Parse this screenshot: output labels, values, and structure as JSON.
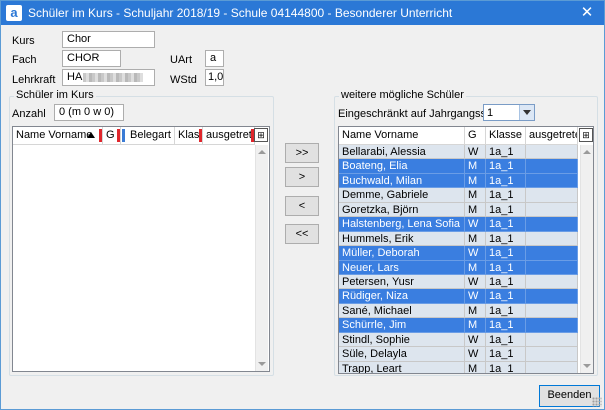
{
  "window": {
    "title": "Schüler im Kurs - Schuljahr 2018/19 - Schule 04144800  - Besonderer Unterricht",
    "app_icon": "a",
    "close": "✕"
  },
  "form": {
    "kurs_label": "Kurs",
    "kurs_value": "Chor",
    "fach_label": "Fach",
    "fach_value": "CHOR",
    "lehrkraft_label": "Lehrkraft",
    "lehrkraft_value": "HA",
    "uart_label": "UArt",
    "uart_value": "a",
    "wstd_label": "WStd",
    "wstd_value": "1,0"
  },
  "left_group": {
    "title": "Schüler im Kurs",
    "anzahl_label": "Anzahl",
    "anzahl_value": "0 (m 0 w 0)",
    "columns": [
      "Name Vorname",
      "G",
      "Belegart",
      "Klasse",
      "ausgetret..."
    ]
  },
  "move_buttons": {
    "add_all": ">>",
    "add": ">",
    "remove": "<",
    "remove_all": "<<"
  },
  "right_group": {
    "title": "weitere mögliche Schüler",
    "filter_label": "Eingeschränkt auf Jahrgangsstufe",
    "filter_value": "1",
    "columns": [
      "Name Vorname",
      "G",
      "Klasse",
      "ausgetreten"
    ],
    "rows": [
      {
        "name": "Bellarabi, Alessia",
        "g": "W",
        "klasse": "1a_1",
        "ausgetreten": "",
        "selected": false
      },
      {
        "name": "Boateng, Elia",
        "g": "M",
        "klasse": "1a_1",
        "ausgetreten": "",
        "selected": true
      },
      {
        "name": "Buchwald, Milan",
        "g": "M",
        "klasse": "1a_1",
        "ausgetreten": "",
        "selected": true
      },
      {
        "name": "Demme, Gabriele",
        "g": "M",
        "klasse": "1a_1",
        "ausgetreten": "",
        "selected": false
      },
      {
        "name": "Goretzka, Björn",
        "g": "M",
        "klasse": "1a_1",
        "ausgetreten": "",
        "selected": false
      },
      {
        "name": "Halstenberg, Lena Sofia",
        "g": "W",
        "klasse": "1a_1",
        "ausgetreten": "",
        "selected": true
      },
      {
        "name": "Hummels, Erik",
        "g": "M",
        "klasse": "1a_1",
        "ausgetreten": "",
        "selected": false
      },
      {
        "name": "Müller, Deborah",
        "g": "W",
        "klasse": "1a_1",
        "ausgetreten": "",
        "selected": true
      },
      {
        "name": "Neuer, Lars",
        "g": "M",
        "klasse": "1a_1",
        "ausgetreten": "",
        "selected": true
      },
      {
        "name": "Petersen, Yusr",
        "g": "W",
        "klasse": "1a_1",
        "ausgetreten": "",
        "selected": false
      },
      {
        "name": "Rüdiger, Niza",
        "g": "W",
        "klasse": "1a_1",
        "ausgetreten": "",
        "selected": true
      },
      {
        "name": "Sané, Michael",
        "g": "M",
        "klasse": "1a_1",
        "ausgetreten": "",
        "selected": false
      },
      {
        "name": "Schürrle, Jim",
        "g": "M",
        "klasse": "1a_1",
        "ausgetreten": "",
        "selected": true
      },
      {
        "name": "Stindl, Sophie",
        "g": "W",
        "klasse": "1a_1",
        "ausgetreten": "",
        "selected": false
      },
      {
        "name": "Süle, Delayla",
        "g": "W",
        "klasse": "1a_1",
        "ausgetreten": "",
        "selected": false
      },
      {
        "name": "Trapp, Leart",
        "g": "M",
        "klasse": "1a_1",
        "ausgetreten": "",
        "selected": false
      }
    ]
  },
  "footer": {
    "close_label": "Beenden"
  },
  "colors": {
    "titlebar": "#2b78d6",
    "selection": "#3a7ee0",
    "header_marker": "#e0262c"
  }
}
